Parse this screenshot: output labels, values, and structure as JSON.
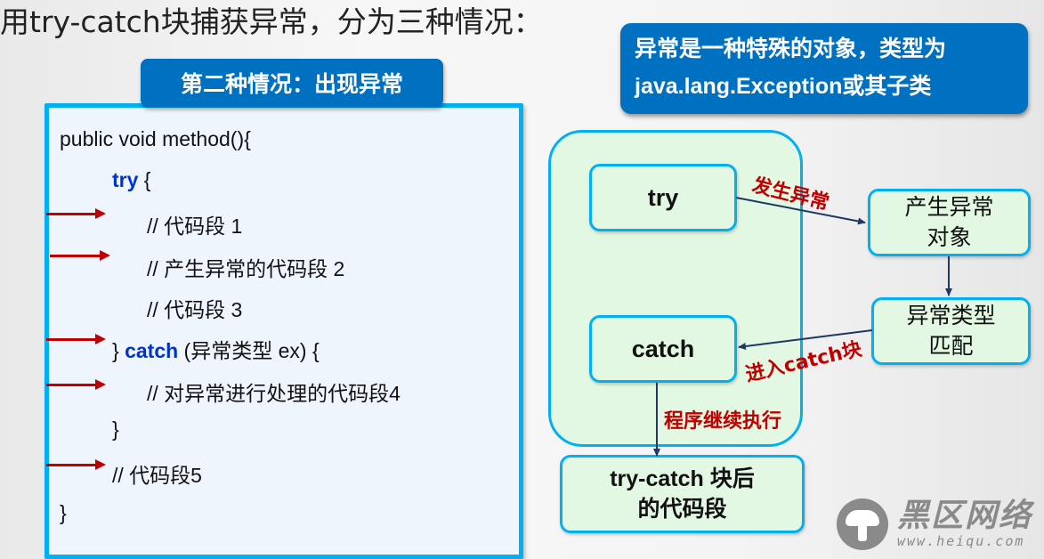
{
  "title": "用try-catch块捕获异常，分为三种情况：",
  "case_label": "第二种情况：出现异常",
  "note": {
    "line1": "异常是一种特殊的对象，类型为",
    "line2": "java.lang.Exception或其子类"
  },
  "code": {
    "line1": "public void method(){",
    "try_kw": "try",
    "try_rest": " {",
    "line3": "// 代码段 1",
    "line4": "// 产生异常的代码段 2",
    "line5": "// 代码段 3",
    "catch_pre": "} ",
    "catch_kw": "catch",
    "catch_rest": " (异常类型 ex) {",
    "line7": "// 对异常进行处理的代码段4",
    "line8": "}",
    "line9": "// 代码段5",
    "line10": "}"
  },
  "flow": {
    "try_node": "try",
    "catch_node": "catch",
    "exception_object_line1": "产生异常",
    "exception_object_line2": "对象",
    "type_match_line1": "异常类型",
    "type_match_line2": "匹配",
    "after_line1": "try-catch 块后",
    "after_line2": "的代码段",
    "label_exception_occurs": "发生异常",
    "label_enter_catch": "进入catch块",
    "label_continue": "程序继续执行"
  },
  "colors": {
    "accent_blue": "#0070c0",
    "border_cyan": "#00b0f0",
    "arrow_red": "#c00000",
    "node_green": "#e2f8e2",
    "keyword_blue": "#0033cc"
  },
  "watermark": {
    "name": "黑区网络",
    "url": "www.heiqu.com"
  }
}
